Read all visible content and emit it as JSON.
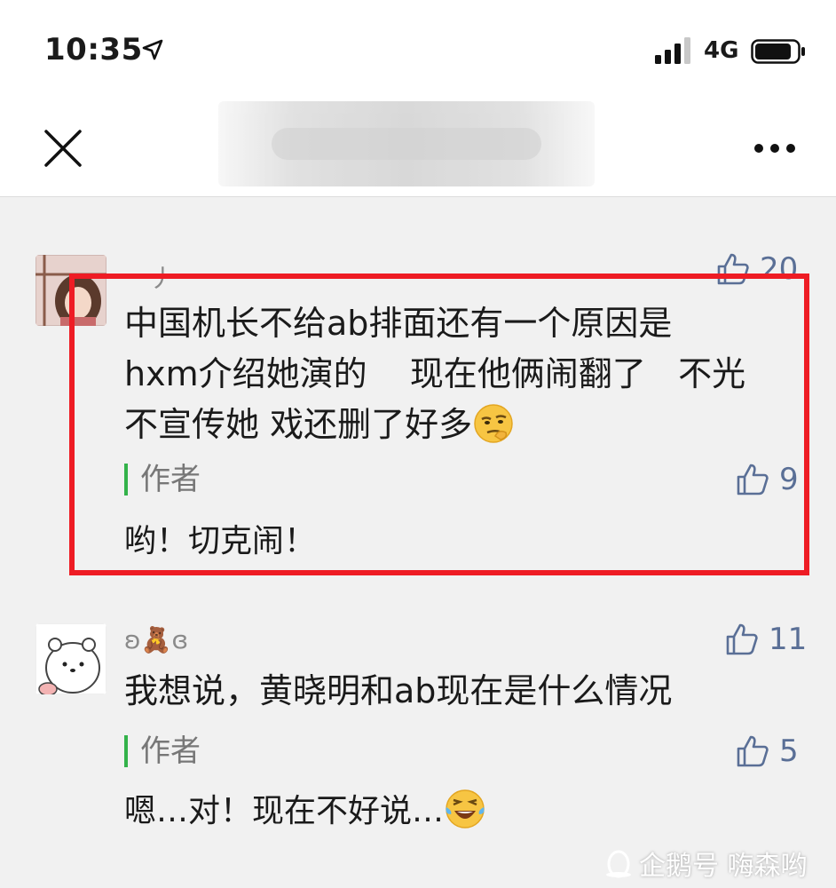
{
  "status_bar": {
    "time": "10:35",
    "network": "4G",
    "icons": [
      "location-arrow-icon",
      "signal-icon",
      "battery-icon"
    ]
  },
  "nav": {
    "close_icon": "close-icon",
    "more_icon": "more-icon"
  },
  "comments": [
    {
      "nickname": "一丿",
      "likes": "20",
      "text_lines": [
        "中国机长不给ab排面还有一个原因是",
        "hxm介绍她演的    现在他俩闹翻了   不光",
        "不宣传她  戏还删了好多"
      ],
      "emoji": "smirk-emoji",
      "author_label": "作者",
      "author_likes": "9",
      "author_reply": "哟！切克闹！"
    },
    {
      "nickname": "ʚ🧸ɞ",
      "likes": "11",
      "text_lines": [
        "我想说，黄晓明和ab现在是什么情况"
      ],
      "author_label": "作者",
      "author_likes": "5",
      "author_reply": "嗯…对！现在不好说…",
      "emoji": "laughing-tears-emoji"
    }
  ],
  "watermark": "企鹅号 嗨森哟",
  "colors": {
    "highlight": "#ee1c24",
    "like": "#5a6f96",
    "author_bar": "#33b24a"
  }
}
